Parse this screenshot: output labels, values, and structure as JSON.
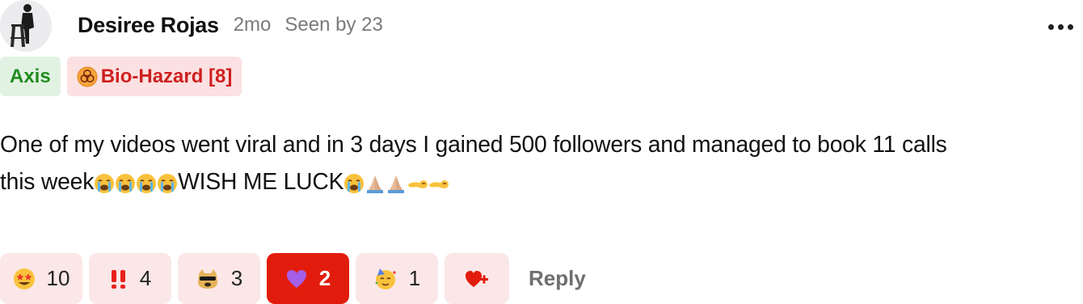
{
  "post": {
    "author": "Desiree Rojas",
    "age": "2mo",
    "seen": "Seen by 23",
    "more_icon": "more-horizontal-icon",
    "tags": [
      {
        "label": "Axis",
        "color": "#218a1f",
        "bg": "#e1f2e2"
      },
      {
        "label": "Bio-Hazard [8]",
        "icon": "biohazard-icon",
        "color": "#d01f1f",
        "bg": "#fbe1e1"
      }
    ],
    "text_line1": "One of my videos went viral and in 3 days I gained 500 followers and managed to book 11 calls",
    "text_line2_a": "this week",
    "text_line2_b": "WISH ME LUCK",
    "inline_emojis": [
      "loudly-crying-face",
      "loudly-crying-face",
      "loudly-crying-face",
      "loudly-crying-face",
      "loudly-crying-face",
      "folded-hands",
      "folded-hands",
      "saluting-hand",
      "saluting-hand"
    ],
    "reactions": [
      {
        "icon": "star-struck-emoji",
        "count": "10"
      },
      {
        "icon": "double-exclamation-emoji",
        "count": "4"
      },
      {
        "icon": "doge-sunglasses-emoji",
        "count": "3"
      },
      {
        "icon": "purple-heart-emoji",
        "count": "2",
        "active": true
      },
      {
        "icon": "partying-face-emoji",
        "count": "1"
      }
    ],
    "add_reaction_icon": "heart-plus-icon",
    "reply_label": "Reply",
    "accent_color": "#e21c0c"
  }
}
